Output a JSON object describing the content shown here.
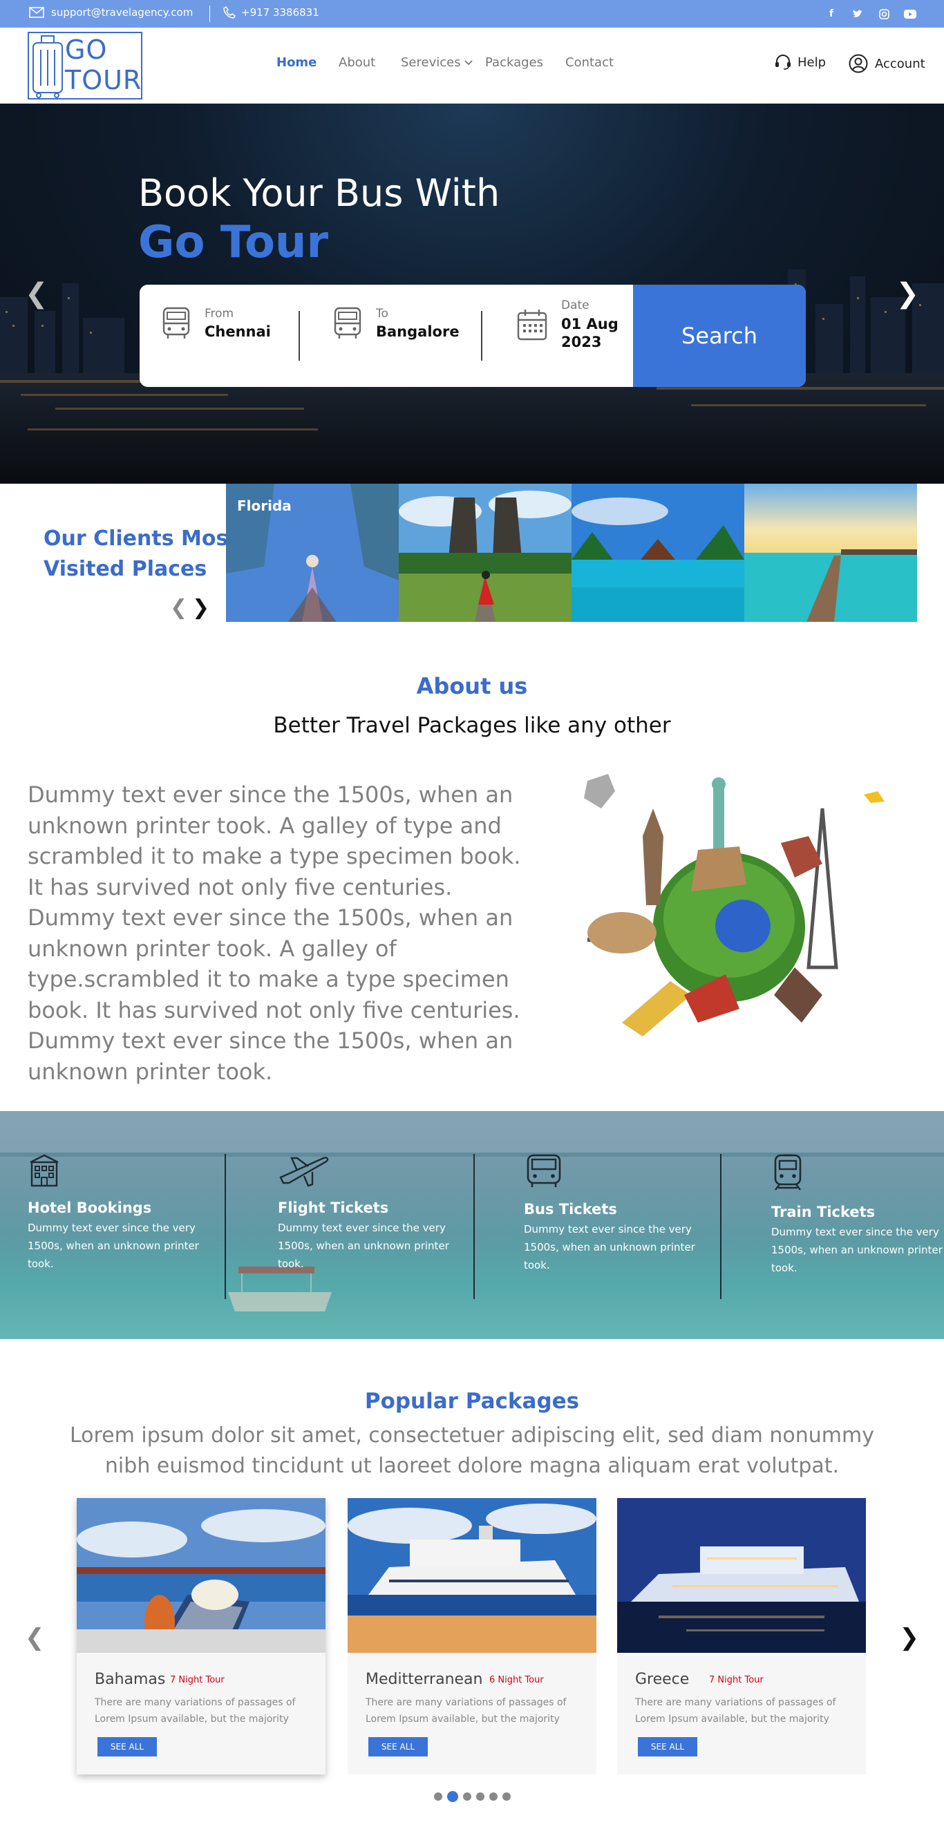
{
  "topbar": {
    "email": "support@travelagency.com",
    "phone": "+917 3386831",
    "social_icons": [
      "facebook-icon",
      "twitter-icon",
      "instagram-icon",
      "youtube-icon"
    ]
  },
  "header": {
    "logo_line1": "GO",
    "logo_line2": "TOUR",
    "nav": {
      "home": "Home",
      "about": "About",
      "services": "Serevices",
      "packages": "Packages",
      "contact": "Contact"
    },
    "help": "Help",
    "account": "Account"
  },
  "hero": {
    "title_line1": "Book Your Bus With",
    "title_line2": "Go Tour",
    "search": {
      "from_label": "From",
      "from_value": "Chennai",
      "to_label": "To",
      "to_value": "Bangalore",
      "date_label": "Date",
      "date_value_line1": "01 Aug",
      "date_value_line2": "2023",
      "button": "Search"
    }
  },
  "clients": {
    "title_line1": "Our Clients Most",
    "title_line2": "Visited Places",
    "places": [
      {
        "caption": "Florida"
      },
      {
        "caption": ""
      },
      {
        "caption": ""
      },
      {
        "caption": ""
      }
    ]
  },
  "about": {
    "title": "About us",
    "subtitle": "Better Travel Packages like any other",
    "body": "Dummy text ever since the 1500s, when an unknown printer took. A galley of type and scrambled it to make a type specimen book. It has survived not only five centuries. Dummy text ever since the 1500s, when an unknown printer took. A galley of type.scrambled it to make a type specimen book. It has survived not only five centuries. Dummy text ever since the 1500s, when an unknown printer took."
  },
  "services": [
    {
      "icon": "hotel-icon",
      "title": "Hotel Bookings",
      "desc": "Dummy text ever since the very 1500s, when an unknown printer took."
    },
    {
      "icon": "airplane-icon",
      "title": "Flight Tickets",
      "desc": "Dummy text ever since the very 1500s, when an unknown printer took."
    },
    {
      "icon": "bus-icon",
      "title": "Bus Tickets",
      "desc": "Dummy text ever since the very 1500s, when an unknown printer took."
    },
    {
      "icon": "train-icon",
      "title": "Train Tickets",
      "desc": "Dummy text ever since the very 1500s, when an unknown printer took."
    }
  ],
  "popular": {
    "title": "Popular Packages",
    "subtitle": "Lorem ipsum dolor sit amet, consectetuer adipiscing elit, sed diam nonummy nibh euismod tincidunt ut laoreet dolore magna aliquam erat volutpat.",
    "cards": [
      {
        "name": "Bahamas",
        "nights": "7 Night Tour",
        "text": "There are many variations of passages of Lorem Ipsum available, but the majority",
        "button": "SEE ALL"
      },
      {
        "name": "Meditterranean",
        "nights": "6 Night Tour",
        "text": "There are many variations of passages of Lorem Ipsum available, but the majority",
        "button": "SEE ALL"
      },
      {
        "name": "Greece",
        "nights": "7 Night Tour",
        "text": "There are many variations of passages of Lorem Ipsum available, but the majority",
        "button": "SEE ALL"
      }
    ],
    "carousel_pages": 6,
    "active_page": 2
  },
  "colors": {
    "accent": "#3b74d9",
    "topbar": "#6f9be6",
    "tour_nights": "#d0021b"
  }
}
